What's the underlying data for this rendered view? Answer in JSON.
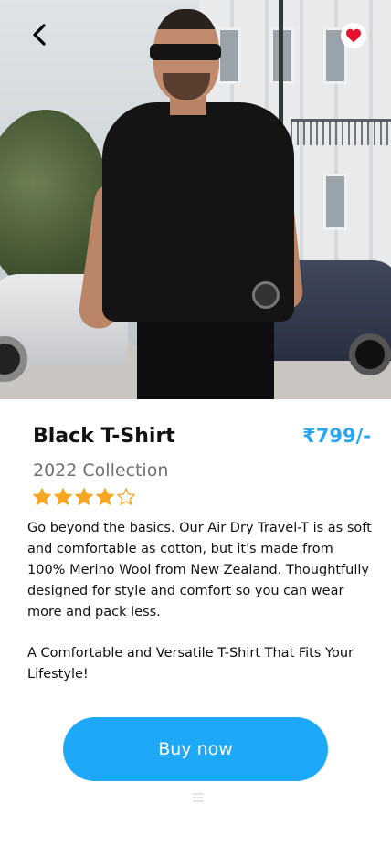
{
  "product": {
    "title": "Black T-Shirt",
    "price": "₹799/-",
    "collection": "2022 Collection",
    "rating": 4,
    "rating_max": 5,
    "description": "Go beyond the basics. Our Air Dry Travel-T is as soft and comfortable as cotton, but it's made from 100% Merino Wool from New Zealand. Thoughtfully designed for style and comfort so you can wear more and pack less.",
    "tagline": "A Comfortable and Versatile T-Shirt That Fits Your Lifestyle!"
  },
  "actions": {
    "buy_label": "Buy now"
  },
  "icons": {
    "back": "chevron-left-icon",
    "favorite": "heart-icon",
    "star_filled": "star-filled-icon",
    "star_empty": "star-outline-icon"
  },
  "colors": {
    "accent": "#1ea9f8",
    "price": "#2aa5f0",
    "star": "#f5a623",
    "heart": "#e8112d",
    "subtitle": "#707070"
  }
}
